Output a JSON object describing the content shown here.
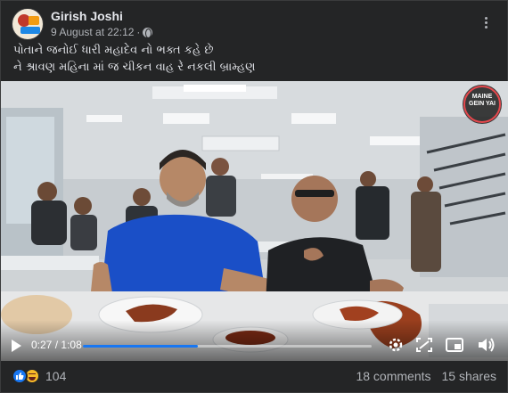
{
  "post": {
    "author": "Girish Joshi",
    "date": "9 August at 22:12",
    "privacy_dot": "·",
    "caption_line1": "પોતાને જનોઈ ધારી મહાદેવ નો ભક્ત કહે છે",
    "caption_line2": "ને શ્રાવણ  મહિના માં જ ચીકન વાહ રે નકલી બ્રામ્હણ"
  },
  "video": {
    "current_time": "0:27",
    "time_separator": "/",
    "duration": "1:08",
    "progress": 0.397,
    "watermark": "MAINE GEIN YAI"
  },
  "footer": {
    "reaction_count": "104",
    "comments": "18 comments",
    "shares": "15 shares"
  },
  "icons": {
    "like": "like-icon",
    "haha": "haha-icon",
    "more": "more-options-icon",
    "globe": "globe-icon",
    "play": "play-icon",
    "settings": "settings-icon",
    "fullscreen": "fullscreen-icon",
    "pip": "picture-in-picture-icon",
    "volume": "volume-icon"
  },
  "colors": {
    "background": "#242526",
    "text": "#e4e6eb",
    "muted": "#b0b3b8",
    "accent": "#1877f2",
    "shirt_blue": "#1a4fc7"
  }
}
